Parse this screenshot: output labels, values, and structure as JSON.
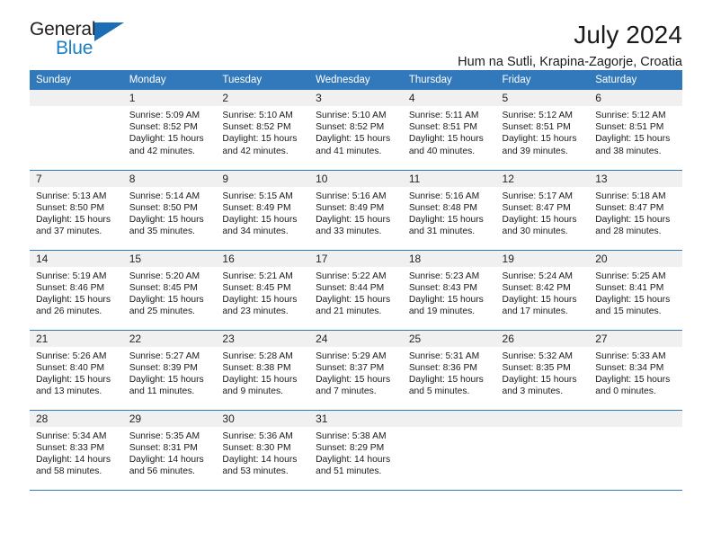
{
  "brand": {
    "name_part1": "General",
    "name_part2": "Blue",
    "accent_color": "#1b6eb5",
    "triangle_icon": "triangle-icon"
  },
  "header": {
    "month_title": "July 2024",
    "location": "Hum na Sutli, Krapina-Zagorje, Croatia",
    "header_bg_color": "#3179ba"
  },
  "weekdays": [
    "Sunday",
    "Monday",
    "Tuesday",
    "Wednesday",
    "Thursday",
    "Friday",
    "Saturday"
  ],
  "weeks": [
    [
      {
        "day": "",
        "blank": true,
        "sunrise": "",
        "sunset": "",
        "daylight_1": "",
        "daylight_2": ""
      },
      {
        "day": "1",
        "blank": false,
        "sunrise": "Sunrise: 5:09 AM",
        "sunset": "Sunset: 8:52 PM",
        "daylight_1": "Daylight: 15 hours",
        "daylight_2": "and 42 minutes."
      },
      {
        "day": "2",
        "blank": false,
        "sunrise": "Sunrise: 5:10 AM",
        "sunset": "Sunset: 8:52 PM",
        "daylight_1": "Daylight: 15 hours",
        "daylight_2": "and 42 minutes."
      },
      {
        "day": "3",
        "blank": false,
        "sunrise": "Sunrise: 5:10 AM",
        "sunset": "Sunset: 8:52 PM",
        "daylight_1": "Daylight: 15 hours",
        "daylight_2": "and 41 minutes."
      },
      {
        "day": "4",
        "blank": false,
        "sunrise": "Sunrise: 5:11 AM",
        "sunset": "Sunset: 8:51 PM",
        "daylight_1": "Daylight: 15 hours",
        "daylight_2": "and 40 minutes."
      },
      {
        "day": "5",
        "blank": false,
        "sunrise": "Sunrise: 5:12 AM",
        "sunset": "Sunset: 8:51 PM",
        "daylight_1": "Daylight: 15 hours",
        "daylight_2": "and 39 minutes."
      },
      {
        "day": "6",
        "blank": false,
        "sunrise": "Sunrise: 5:12 AM",
        "sunset": "Sunset: 8:51 PM",
        "daylight_1": "Daylight: 15 hours",
        "daylight_2": "and 38 minutes."
      }
    ],
    [
      {
        "day": "7",
        "blank": false,
        "sunrise": "Sunrise: 5:13 AM",
        "sunset": "Sunset: 8:50 PM",
        "daylight_1": "Daylight: 15 hours",
        "daylight_2": "and 37 minutes."
      },
      {
        "day": "8",
        "blank": false,
        "sunrise": "Sunrise: 5:14 AM",
        "sunset": "Sunset: 8:50 PM",
        "daylight_1": "Daylight: 15 hours",
        "daylight_2": "and 35 minutes."
      },
      {
        "day": "9",
        "blank": false,
        "sunrise": "Sunrise: 5:15 AM",
        "sunset": "Sunset: 8:49 PM",
        "daylight_1": "Daylight: 15 hours",
        "daylight_2": "and 34 minutes."
      },
      {
        "day": "10",
        "blank": false,
        "sunrise": "Sunrise: 5:16 AM",
        "sunset": "Sunset: 8:49 PM",
        "daylight_1": "Daylight: 15 hours",
        "daylight_2": "and 33 minutes."
      },
      {
        "day": "11",
        "blank": false,
        "sunrise": "Sunrise: 5:16 AM",
        "sunset": "Sunset: 8:48 PM",
        "daylight_1": "Daylight: 15 hours",
        "daylight_2": "and 31 minutes."
      },
      {
        "day": "12",
        "blank": false,
        "sunrise": "Sunrise: 5:17 AM",
        "sunset": "Sunset: 8:47 PM",
        "daylight_1": "Daylight: 15 hours",
        "daylight_2": "and 30 minutes."
      },
      {
        "day": "13",
        "blank": false,
        "sunrise": "Sunrise: 5:18 AM",
        "sunset": "Sunset: 8:47 PM",
        "daylight_1": "Daylight: 15 hours",
        "daylight_2": "and 28 minutes."
      }
    ],
    [
      {
        "day": "14",
        "blank": false,
        "sunrise": "Sunrise: 5:19 AM",
        "sunset": "Sunset: 8:46 PM",
        "daylight_1": "Daylight: 15 hours",
        "daylight_2": "and 26 minutes."
      },
      {
        "day": "15",
        "blank": false,
        "sunrise": "Sunrise: 5:20 AM",
        "sunset": "Sunset: 8:45 PM",
        "daylight_1": "Daylight: 15 hours",
        "daylight_2": "and 25 minutes."
      },
      {
        "day": "16",
        "blank": false,
        "sunrise": "Sunrise: 5:21 AM",
        "sunset": "Sunset: 8:45 PM",
        "daylight_1": "Daylight: 15 hours",
        "daylight_2": "and 23 minutes."
      },
      {
        "day": "17",
        "blank": false,
        "sunrise": "Sunrise: 5:22 AM",
        "sunset": "Sunset: 8:44 PM",
        "daylight_1": "Daylight: 15 hours",
        "daylight_2": "and 21 minutes."
      },
      {
        "day": "18",
        "blank": false,
        "sunrise": "Sunrise: 5:23 AM",
        "sunset": "Sunset: 8:43 PM",
        "daylight_1": "Daylight: 15 hours",
        "daylight_2": "and 19 minutes."
      },
      {
        "day": "19",
        "blank": false,
        "sunrise": "Sunrise: 5:24 AM",
        "sunset": "Sunset: 8:42 PM",
        "daylight_1": "Daylight: 15 hours",
        "daylight_2": "and 17 minutes."
      },
      {
        "day": "20",
        "blank": false,
        "sunrise": "Sunrise: 5:25 AM",
        "sunset": "Sunset: 8:41 PM",
        "daylight_1": "Daylight: 15 hours",
        "daylight_2": "and 15 minutes."
      }
    ],
    [
      {
        "day": "21",
        "blank": false,
        "sunrise": "Sunrise: 5:26 AM",
        "sunset": "Sunset: 8:40 PM",
        "daylight_1": "Daylight: 15 hours",
        "daylight_2": "and 13 minutes."
      },
      {
        "day": "22",
        "blank": false,
        "sunrise": "Sunrise: 5:27 AM",
        "sunset": "Sunset: 8:39 PM",
        "daylight_1": "Daylight: 15 hours",
        "daylight_2": "and 11 minutes."
      },
      {
        "day": "23",
        "blank": false,
        "sunrise": "Sunrise: 5:28 AM",
        "sunset": "Sunset: 8:38 PM",
        "daylight_1": "Daylight: 15 hours",
        "daylight_2": "and 9 minutes."
      },
      {
        "day": "24",
        "blank": false,
        "sunrise": "Sunrise: 5:29 AM",
        "sunset": "Sunset: 8:37 PM",
        "daylight_1": "Daylight: 15 hours",
        "daylight_2": "and 7 minutes."
      },
      {
        "day": "25",
        "blank": false,
        "sunrise": "Sunrise: 5:31 AM",
        "sunset": "Sunset: 8:36 PM",
        "daylight_1": "Daylight: 15 hours",
        "daylight_2": "and 5 minutes."
      },
      {
        "day": "26",
        "blank": false,
        "sunrise": "Sunrise: 5:32 AM",
        "sunset": "Sunset: 8:35 PM",
        "daylight_1": "Daylight: 15 hours",
        "daylight_2": "and 3 minutes."
      },
      {
        "day": "27",
        "blank": false,
        "sunrise": "Sunrise: 5:33 AM",
        "sunset": "Sunset: 8:34 PM",
        "daylight_1": "Daylight: 15 hours",
        "daylight_2": "and 0 minutes."
      }
    ],
    [
      {
        "day": "28",
        "blank": false,
        "sunrise": "Sunrise: 5:34 AM",
        "sunset": "Sunset: 8:33 PM",
        "daylight_1": "Daylight: 14 hours",
        "daylight_2": "and 58 minutes."
      },
      {
        "day": "29",
        "blank": false,
        "sunrise": "Sunrise: 5:35 AM",
        "sunset": "Sunset: 8:31 PM",
        "daylight_1": "Daylight: 14 hours",
        "daylight_2": "and 56 minutes."
      },
      {
        "day": "30",
        "blank": false,
        "sunrise": "Sunrise: 5:36 AM",
        "sunset": "Sunset: 8:30 PM",
        "daylight_1": "Daylight: 14 hours",
        "daylight_2": "and 53 minutes."
      },
      {
        "day": "31",
        "blank": false,
        "sunrise": "Sunrise: 5:38 AM",
        "sunset": "Sunset: 8:29 PM",
        "daylight_1": "Daylight: 14 hours",
        "daylight_2": "and 51 minutes."
      },
      {
        "day": "",
        "blank": true,
        "sunrise": "",
        "sunset": "",
        "daylight_1": "",
        "daylight_2": ""
      },
      {
        "day": "",
        "blank": true,
        "sunrise": "",
        "sunset": "",
        "daylight_1": "",
        "daylight_2": ""
      },
      {
        "day": "",
        "blank": true,
        "sunrise": "",
        "sunset": "",
        "daylight_1": "",
        "daylight_2": ""
      }
    ]
  ]
}
